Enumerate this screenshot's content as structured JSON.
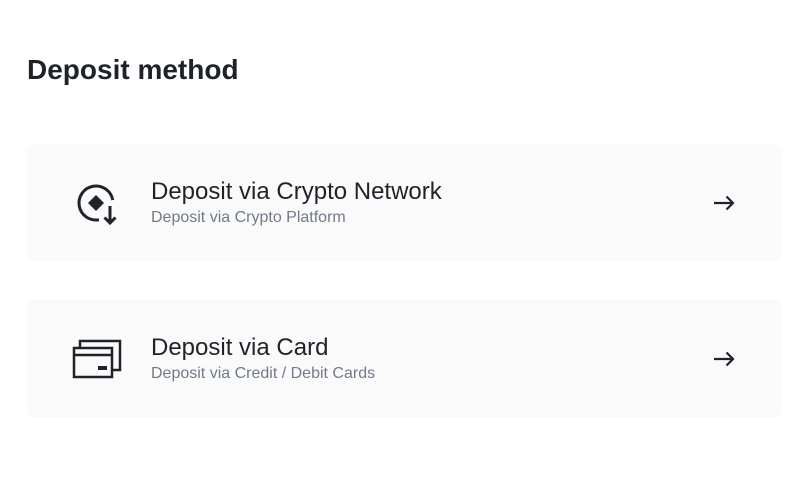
{
  "page": {
    "title": "Deposit method"
  },
  "methods": [
    {
      "title": "Deposit via Crypto Network",
      "subtitle": "Deposit via Crypto Platform",
      "icon": "crypto-deposit-icon",
      "action_icon": "arrow-right-icon"
    },
    {
      "title": "Deposit via Card",
      "subtitle": "Deposit via Credit / Debit Cards",
      "icon": "card-icon",
      "action_icon": "arrow-right-icon"
    }
  ],
  "colors": {
    "text_primary": "#1e2329",
    "text_secondary": "#707a8a",
    "card_background": "#fafafa",
    "page_background": "#ffffff"
  }
}
